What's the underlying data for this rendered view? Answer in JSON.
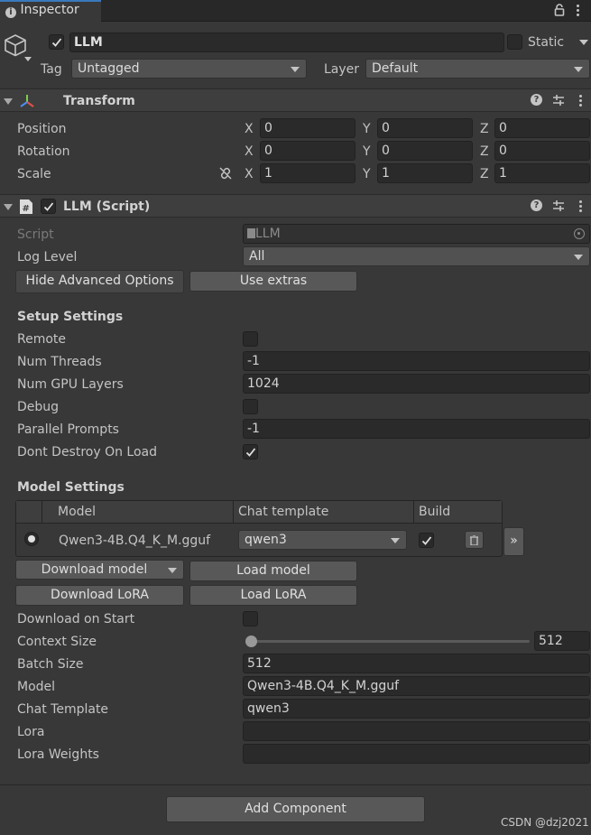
{
  "window": {
    "tab_title": "Inspector"
  },
  "object": {
    "name": "LLM",
    "active": true,
    "static_label": "Static",
    "static": false,
    "tag_label": "Tag",
    "tag_value": "Untagged",
    "layer_label": "Layer",
    "layer_value": "Default"
  },
  "transform": {
    "title": "Transform",
    "rows": [
      {
        "label": "Position",
        "x": "0",
        "y": "0",
        "z": "0"
      },
      {
        "label": "Rotation",
        "x": "0",
        "y": "0",
        "z": "0"
      },
      {
        "label": "Scale",
        "x": "1",
        "y": "1",
        "z": "1"
      }
    ],
    "axis_x": "X",
    "axis_y": "Y",
    "axis_z": "Z"
  },
  "llm_script": {
    "title": "LLM (Script)",
    "enabled": true,
    "script_label": "Script",
    "script_value": "LLM",
    "log_level_label": "Log Level",
    "log_level_value": "All",
    "hide_advanced_button": "Hide Advanced Options",
    "use_extras_button": "Use extras",
    "setup_settings_heading": "Setup Settings",
    "remote_label": "Remote",
    "remote": false,
    "num_threads_label": "Num Threads",
    "num_threads_value": "-1",
    "num_gpu_layers_label": "Num GPU Layers",
    "num_gpu_layers_value": "1024",
    "debug_label": "Debug",
    "debug": false,
    "parallel_prompts_label": "Parallel Prompts",
    "parallel_prompts_value": "-1",
    "dont_destroy_label": "Dont Destroy On Load",
    "dont_destroy": true,
    "model_settings_heading": "Model Settings",
    "model_table": {
      "col_model": "Model",
      "col_chat_template": "Chat template",
      "col_build": "Build",
      "rows": [
        {
          "model": "Qwen3-4B.Q4_K_M.gguf",
          "chat_template": "qwen3",
          "build": true,
          "selected": true
        }
      ],
      "expand_label": "»"
    },
    "download_model_button": "Download model",
    "load_model_button": "Load model",
    "download_lora_button": "Download LoRA",
    "load_lora_button": "Load LoRA",
    "download_on_start_label": "Download on Start",
    "download_on_start": false,
    "context_size_label": "Context Size",
    "context_size_value": "512",
    "context_size_slider_fraction": 0.0,
    "batch_size_label": "Batch Size",
    "batch_size_value": "512",
    "model_label": "Model",
    "model_value": "Qwen3-4B.Q4_K_M.gguf",
    "chat_template_label": "Chat Template",
    "chat_template_value": "qwen3",
    "lora_label": "Lora",
    "lora_value": "",
    "lora_weights_label": "Lora Weights",
    "lora_weights_value": ""
  },
  "add_component_button": "Add Component",
  "watermark": "CSDN @dzj2021",
  "colors": {
    "accent": "#3a79bb",
    "panel": "#383838",
    "field": "#2a2a2a",
    "button": "#585858"
  }
}
